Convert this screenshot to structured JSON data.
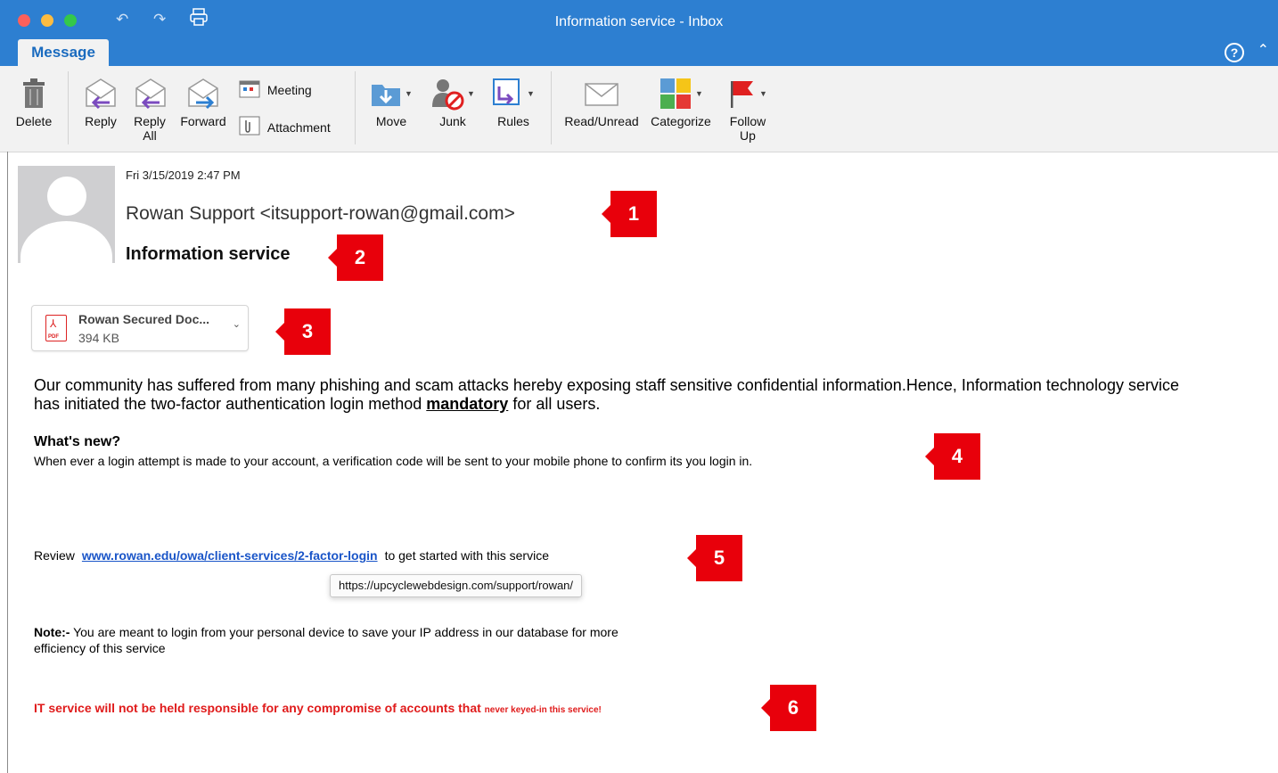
{
  "window": {
    "title": "Information service - Inbox"
  },
  "tabs": {
    "message": "Message"
  },
  "ribbon": {
    "delete": "Delete",
    "reply": "Reply",
    "reply_all_1": "Reply",
    "reply_all_2": "All",
    "forward": "Forward",
    "meeting": "Meeting",
    "attachment": "Attachment",
    "move": "Move",
    "junk": "Junk",
    "rules": "Rules",
    "read_unread": "Read/Unread",
    "categorize": "Categorize",
    "follow_up_1": "Follow",
    "follow_up_2": "Up"
  },
  "email": {
    "date": "Fri 3/15/2019 2:47 PM",
    "sender": "Rowan Support <itsupport-rowan@gmail.com>",
    "subject": "Information service",
    "attachment_name": "Rowan Secured Doc...",
    "attachment_size": "394 KB",
    "para1_a": "Our community has suffered from many phishing and scam attacks hereby exposing staff sensitive confidential information.Hence, Information technology service has initiated the two-factor authentication login method ",
    "para1_mandatory": "mandatory",
    "para1_b": " for all users.",
    "whats_new_heading": "What's new?",
    "whats_new_body": "When ever a login attempt is made to your account, a verification code will be sent to your mobile phone to confirm its you login in.",
    "review_prefix": "Review",
    "review_link": "www.rowan.edu/owa/client-services/2-factor-login",
    "review_suffix": "to get started with this service",
    "tooltip_url": "https://upcyclewebdesign.com/support/rowan/",
    "note_label": "Note:-",
    "note_text": " You are meant to login from your personal device to save your IP address in our database for more efficiency of this service",
    "warning_main": "IT service will not be held responsible for any compromise of accounts that ",
    "warning_small": "never keyed-in this service!"
  },
  "callouts": [
    "1",
    "2",
    "3",
    "4",
    "5",
    "6"
  ],
  "colors": {
    "titlebar": "#2d7fd1",
    "callout": "#e8000b",
    "link": "#1a55c8",
    "warning": "#e01b1b"
  }
}
